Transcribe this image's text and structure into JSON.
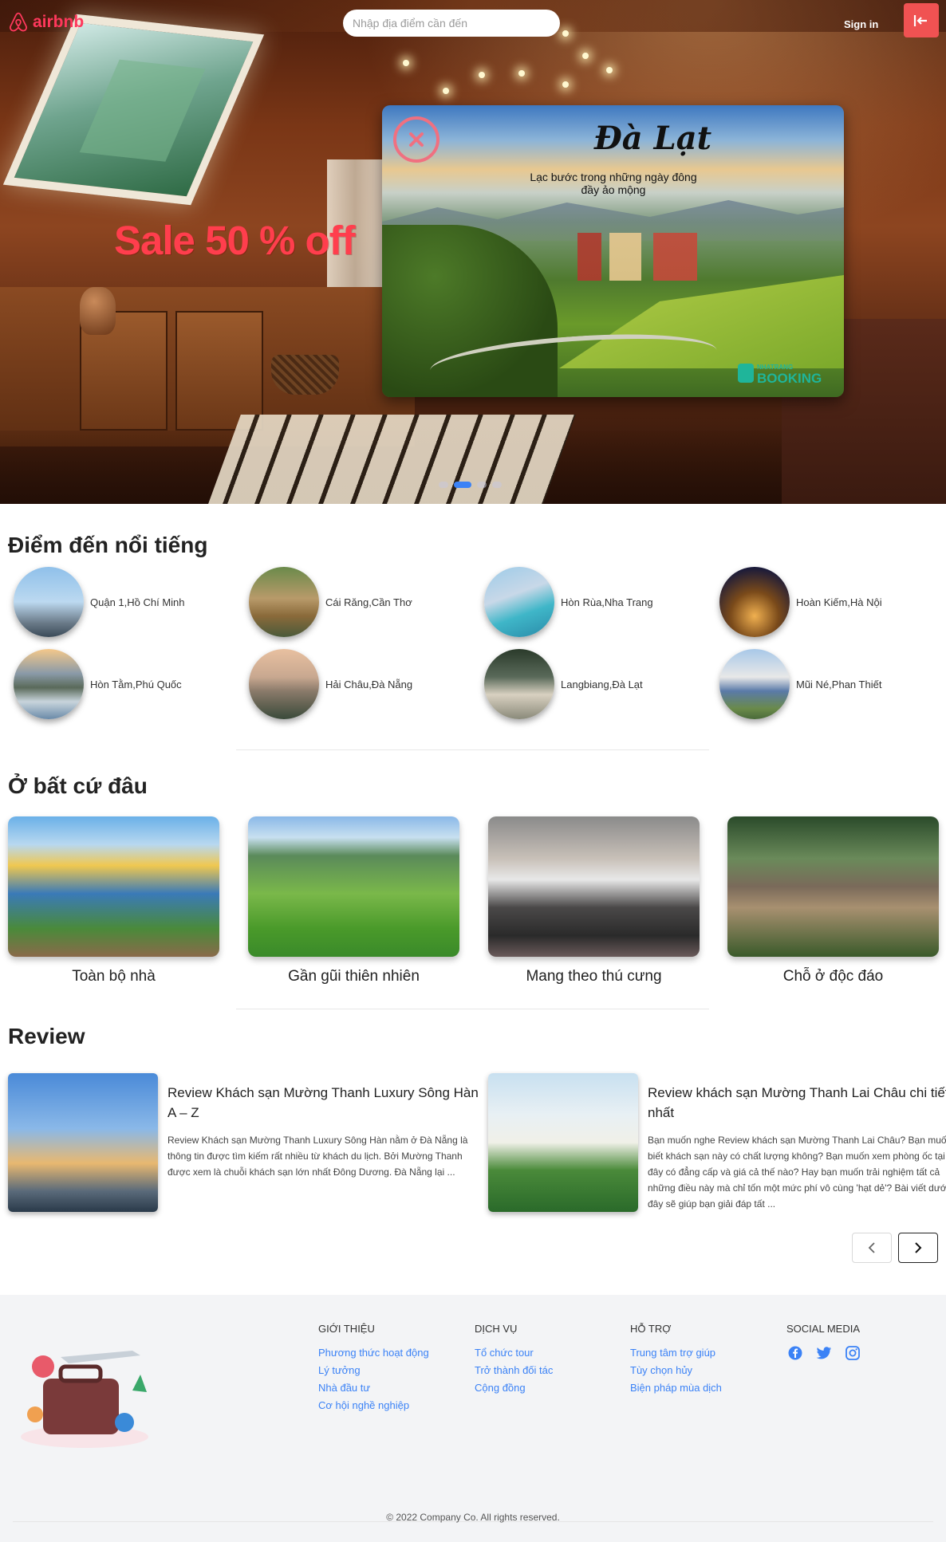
{
  "nav": {
    "logo_text": "airbnb",
    "search_placeholder": "Nhập địa điểm cần đến",
    "signin_label": "Sign in",
    "logout_icon": "logout-arrow-icon"
  },
  "hero": {
    "sale_text": "Sale 50 % off",
    "carousel_slides": 4,
    "active_slide": 2
  },
  "popup": {
    "title": "Đà Lạt",
    "subtitle": "Lạc bước trong những ngày đông đầy ảo mộng",
    "brand_small": "NHATRANG",
    "brand": "BOOKING",
    "close_icon": "close-circle-icon"
  },
  "popular": {
    "heading": "Điểm đến nổi tiếng",
    "items": [
      {
        "name": "Quận 1,Hồ Chí Minh"
      },
      {
        "name": "Cái Răng,Cần Thơ"
      },
      {
        "name": "Hòn Rùa,Nha Trang"
      },
      {
        "name": "Hoàn Kiếm,Hà Nội"
      },
      {
        "name": "Hòn Tằm,Phú Quốc"
      },
      {
        "name": "Hải Châu,Đà Nẵng"
      },
      {
        "name": "Langbiang,Đà Lạt"
      },
      {
        "name": "Mũi Né,Phan Thiết"
      }
    ]
  },
  "anywhere": {
    "heading": "Ở bất cứ đâu",
    "items": [
      {
        "label": "Toàn bộ nhà"
      },
      {
        "label": "Gần gũi thiên nhiên"
      },
      {
        "label": "Mang theo thú cưng"
      },
      {
        "label": "Chỗ ở độc đáo"
      }
    ]
  },
  "review": {
    "heading": "Review",
    "items": [
      {
        "title": "Review Khách sạn Mường Thanh Luxury Sông Hàn A – Z",
        "text": "Review Khách sạn Mường Thanh Luxury Sông Hàn nằm ở Đà Nẵng là thông tin được tìm kiếm rất nhiều từ khách du lịch. Bởi Mường Thanh được xem là chuỗi khách sạn lớn nhất Đông Dương. Đà Nẵng lại ..."
      },
      {
        "title": "Review khách sạn Mường Thanh Lai Châu chi tiết nhất",
        "text": "Bạn muốn nghe Review khách sạn Mường Thanh Lai Châu? Bạn muốn biết khách sạn này có chất lượng không? Bạn muốn xem phòng ốc tại đây có đẳng cấp và giá cả thế nào? Hay bạn muốn trải nghiệm tất cả những điều này mà chỉ tốn một mức phí vô cùng 'hạt dẻ'? Bài viết dưới đây sẽ giúp bạn giải đáp tất ..."
      }
    ],
    "prev_icon": "chevron-left-icon",
    "next_icon": "chevron-right-icon"
  },
  "footer": {
    "columns": [
      {
        "heading": "Giới thiệu",
        "links": [
          "Phương thức hoạt động",
          "Lý tưởng",
          "Nhà đầu tư",
          "Cơ hội nghề nghiệp"
        ]
      },
      {
        "heading": "Dịch vụ",
        "links": [
          "Tổ chức tour",
          "Trở thành đối tác",
          "Cộng đồng"
        ]
      },
      {
        "heading": "Hỗ trợ",
        "links": [
          "Trung tâm trợ giúp",
          "Tùy chọn hủy",
          "Biện pháp mùa dịch"
        ]
      }
    ],
    "social_heading": "Social media",
    "social_icons": [
      "facebook-icon",
      "twitter-icon",
      "instagram-icon"
    ],
    "copyright": "© 2022 Company Co. All rights reserved.",
    "colors": {
      "link": "#3b82f6",
      "accent": "#ff385c",
      "background": "#f3f4f6"
    }
  }
}
